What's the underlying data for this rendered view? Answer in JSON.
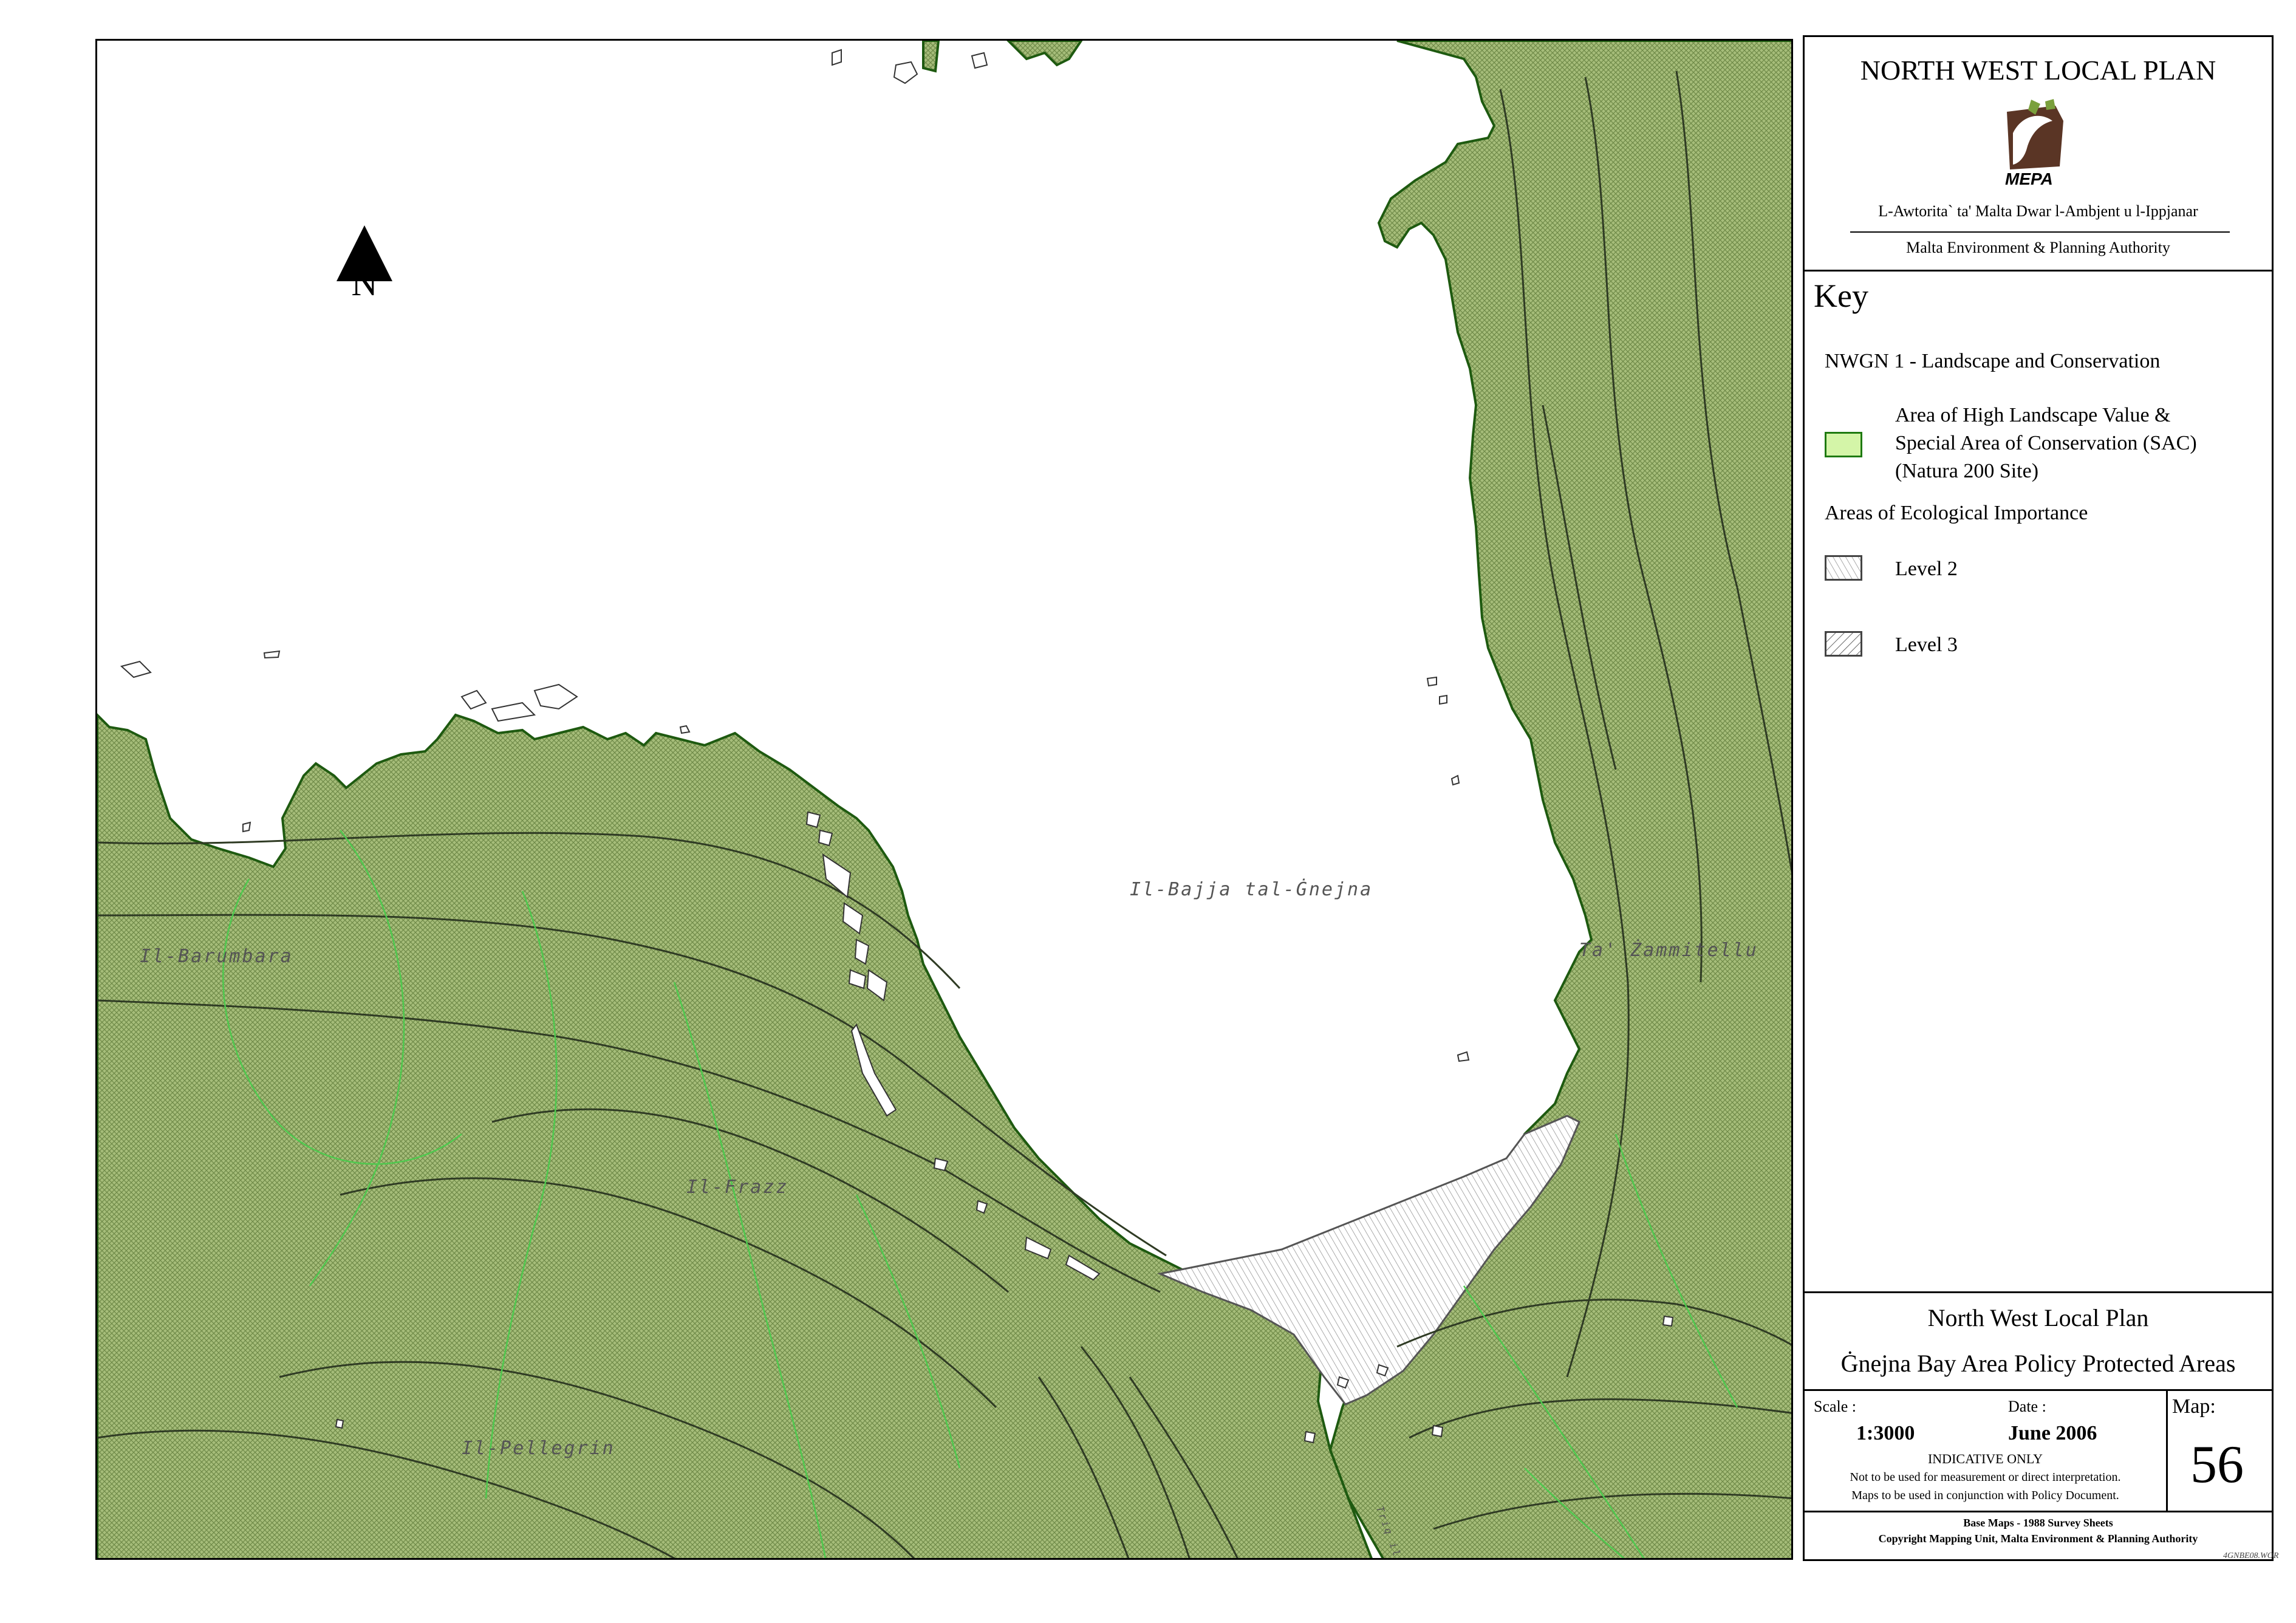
{
  "header": {
    "title": "NORTH WEST LOCAL PLAN",
    "logo_text": "MEPA",
    "authority_maltese": "L-Awtorita` ta' Malta Dwar l-Ambjent u l-Ippjanar",
    "authority_english": "Malta Environment & Planning Authority"
  },
  "map": {
    "north_label": "N",
    "place_labels": {
      "bay": "Il-Bajja tal-Ġnejna",
      "east": "Ta' Żammitellu",
      "west": "Il-Barumbara",
      "middle": "Il-Frazz",
      "south": "Il-Pellegrin",
      "road": "Triq il-Ġnejna"
    },
    "colors": {
      "sac_fill": "#a6bd7a",
      "sac_hatch": "#5f7a3a",
      "coast_line": "#1e5a10",
      "contour": "#3a4a2a",
      "green_contour": "#4ec94e",
      "level2_hatch": "#888888"
    }
  },
  "key": {
    "heading": "Key",
    "section1": "NWGN 1 - Landscape and Conservation",
    "item1_lines": [
      "Area of High Landscape Value &",
      "Special Area of Conservation (SAC)",
      "(Natura 200 Site)"
    ],
    "section2": "Areas of Ecological Importance",
    "level2": "Level 2",
    "level3": "Level 3"
  },
  "footer": {
    "plan_title": "North West Local Plan",
    "map_title": "Ġnejna Bay Area Policy Protected Areas",
    "scale_label": "Scale :",
    "scale_value": "1:3000",
    "date_label": "Date :",
    "date_value": "June 2006",
    "indicative": "INDICATIVE ONLY",
    "note1": "Not to be used for measurement or direct interpretation.",
    "note2": "Maps to be used in conjunction with Policy Document.",
    "map_label": "Map:",
    "map_number": "56",
    "base_maps": "Base Maps - 1988 Survey Sheets",
    "copyright": "Copyright Mapping Unit, Malta Environment & Planning Authority",
    "file_code": "4GNBE08.WOR"
  }
}
